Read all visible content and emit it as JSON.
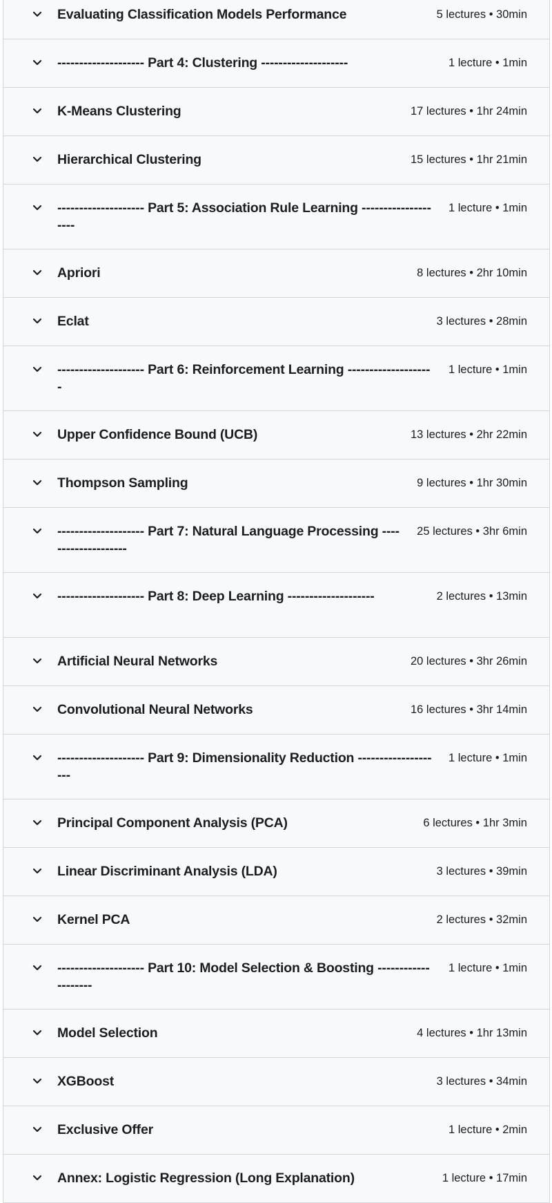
{
  "curriculum": {
    "sections": [
      {
        "title": "Evaluating Classification Models Performance",
        "meta": "5 lectures • 30min",
        "tall": false
      },
      {
        "title": "-------------------- Part 4: Clustering --------------------",
        "meta": "1 lecture • 1min",
        "tall": false
      },
      {
        "title": "K-Means Clustering",
        "meta": "17 lectures • 1hr 24min",
        "tall": false
      },
      {
        "title": "Hierarchical Clustering",
        "meta": "15 lectures • 1hr 21min",
        "tall": false
      },
      {
        "title": "-------------------- Part 5: Association Rule Learning --------------------",
        "meta": "1 lecture • 1min",
        "tall": true
      },
      {
        "title": "Apriori",
        "meta": "8 lectures • 2hr 10min",
        "tall": false
      },
      {
        "title": "Eclat",
        "meta": "3 lectures • 28min",
        "tall": false
      },
      {
        "title": "-------------------- Part 6: Reinforcement Learning --------------------",
        "meta": "1 lecture • 1min",
        "tall": true
      },
      {
        "title": "Upper Confidence Bound (UCB)",
        "meta": "13 lectures • 2hr 22min",
        "tall": false
      },
      {
        "title": "Thompson Sampling",
        "meta": "9 lectures • 1hr 30min",
        "tall": false
      },
      {
        "title": "-------------------- Part 7: Natural Language Processing --------------------",
        "meta": "25 lectures • 3hr 6min",
        "tall": true
      },
      {
        "title": "-------------------- Part 8: Deep Learning --------------------",
        "meta": "2 lectures • 13min",
        "tall": true
      },
      {
        "title": "Artificial Neural Networks",
        "meta": "20 lectures • 3hr 26min",
        "tall": false
      },
      {
        "title": "Convolutional Neural Networks",
        "meta": "16 lectures • 3hr 14min",
        "tall": false
      },
      {
        "title": "-------------------- Part 9: Dimensionality Reduction --------------------",
        "meta": "1 lecture • 1min",
        "tall": true
      },
      {
        "title": "Principal Component Analysis (PCA)",
        "meta": "6 lectures • 1hr 3min",
        "tall": false
      },
      {
        "title": "Linear Discriminant Analysis (LDA)",
        "meta": "3 lectures • 39min",
        "tall": false
      },
      {
        "title": "Kernel PCA",
        "meta": "2 lectures • 32min",
        "tall": false
      },
      {
        "title": "-------------------- Part 10: Model Selection & Boosting --------------------",
        "meta": "1 lecture • 1min",
        "tall": true
      },
      {
        "title": "Model Selection",
        "meta": "4 lectures • 1hr 13min",
        "tall": false
      },
      {
        "title": "XGBoost",
        "meta": "3 lectures • 34min",
        "tall": false
      },
      {
        "title": "Exclusive Offer",
        "meta": "1 lecture • 2min",
        "tall": false
      },
      {
        "title": "Annex: Logistic Regression (Long Explanation)",
        "meta": "1 lecture • 17min",
        "tall": false
      }
    ],
    "icons": {
      "expand": "chevron-down-icon"
    }
  }
}
